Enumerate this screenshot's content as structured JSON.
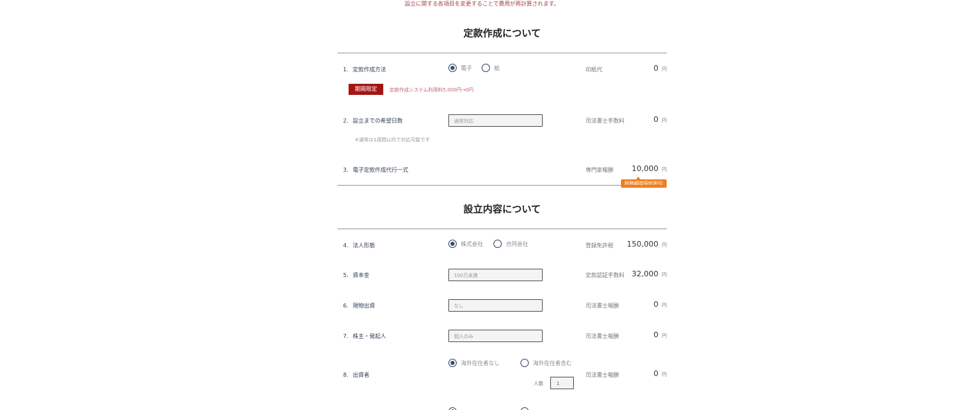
{
  "notice": "設立に関する各項目を変更することで費用が再計算されます。",
  "sections": {
    "articles_title": "定款作成について",
    "establishment_title": "設立内容について"
  },
  "rows": {
    "r1": {
      "num": "1.",
      "label": "定款作成方法",
      "options": [
        "電子",
        "紙"
      ],
      "selected": "電子",
      "fee_label": "印紙代",
      "fee_value": "0",
      "unit": "円",
      "badge": "期間限定",
      "promo": "定款作成システム利用料5,000円→0円"
    },
    "r2": {
      "num": "2.",
      "label": "設立までの希望日数",
      "select_value": "通常対応",
      "note": "※通常は1週間以内で対応可能です",
      "fee_label": "司法書士手数料",
      "fee_value": "0",
      "unit": "円"
    },
    "r3": {
      "num": "3.",
      "label": "電子定款作成代行一式",
      "fee_label": "専門家報酬",
      "fee_value": "10,000",
      "unit": "円",
      "badge": "税務顧問契約割引"
    },
    "r4": {
      "num": "4.",
      "label": "法人形態",
      "options": [
        "株式会社",
        "合同会社"
      ],
      "selected": "株式会社",
      "fee_label": "登録免許税",
      "fee_value": "150,000",
      "unit": "円"
    },
    "r5": {
      "num": "5.",
      "label": "資本金",
      "select_value": "100万未満",
      "fee_label": "定款認証手数料",
      "fee_value": "32,000",
      "unit": "円"
    },
    "r6": {
      "num": "6.",
      "label": "現物出資",
      "select_value": "なし",
      "fee_label": "司法書士報酬",
      "fee_value": "0",
      "unit": "円"
    },
    "r7": {
      "num": "7.",
      "label": "株主・発起人",
      "select_value": "個人のみ",
      "fee_label": "司法書士報酬",
      "fee_value": "0",
      "unit": "円"
    },
    "r8": {
      "num": "8.",
      "label": "出資者",
      "options": [
        "海外在住者なし",
        "海外在住者含む"
      ],
      "selected": "海外在住者なし",
      "count_label": "人数",
      "count_value": "1",
      "fee_label": "司法書士報酬",
      "fee_value": "0",
      "unit": "円"
    }
  },
  "colors": {
    "accent": "#3a4d6b",
    "badge_red": "#a31515",
    "badge_orange": "#f07d1b",
    "notice_text": "#a0434e"
  }
}
